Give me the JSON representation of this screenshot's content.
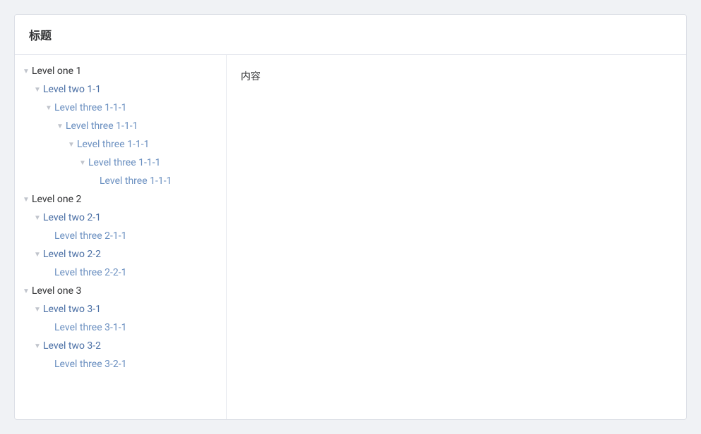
{
  "header": {
    "title": "标题"
  },
  "content": {
    "text": "内容"
  },
  "tree": [
    {
      "id": "one1",
      "label": "Level one 1",
      "level": "level-one",
      "indent": 0,
      "arrow": "expanded",
      "children": [
        {
          "id": "two1-1",
          "label": "Level two 1-1",
          "level": "level-two",
          "indent": 1,
          "arrow": "expanded",
          "children": [
            {
              "id": "three1-1-1a",
              "label": "Level three 1-1-1",
              "level": "level-three",
              "indent": 2,
              "arrow": "expanded",
              "children": [
                {
                  "id": "three1-1-1b",
                  "label": "Level three 1-1-1",
                  "level": "level-three",
                  "indent": 3,
                  "arrow": "expanded",
                  "children": [
                    {
                      "id": "three1-1-1c",
                      "label": "Level three 1-1-1",
                      "level": "level-three",
                      "indent": 4,
                      "arrow": "expanded",
                      "children": [
                        {
                          "id": "three1-1-1d",
                          "label": "Level three 1-1-1",
                          "level": "level-three",
                          "indent": 5,
                          "arrow": "expanded",
                          "children": [
                            {
                              "id": "three1-1-1e",
                              "label": "Level three 1-1-1",
                              "level": "level-three",
                              "indent": 6,
                              "arrow": "leaf",
                              "children": []
                            }
                          ]
                        }
                      ]
                    }
                  ]
                }
              ]
            }
          ]
        }
      ]
    },
    {
      "id": "one2",
      "label": "Level one 2",
      "level": "level-one",
      "indent": 0,
      "arrow": "expanded",
      "children": [
        {
          "id": "two2-1",
          "label": "Level two 2-1",
          "level": "level-two",
          "indent": 1,
          "arrow": "expanded",
          "children": [
            {
              "id": "three2-1-1",
              "label": "Level three 2-1-1",
              "level": "level-three",
              "indent": 2,
              "arrow": "leaf",
              "children": []
            }
          ]
        },
        {
          "id": "two2-2",
          "label": "Level two 2-2",
          "level": "level-two",
          "indent": 1,
          "arrow": "expanded",
          "children": [
            {
              "id": "three2-2-1",
              "label": "Level three 2-2-1",
              "level": "level-three",
              "indent": 2,
              "arrow": "leaf",
              "children": []
            }
          ]
        }
      ]
    },
    {
      "id": "one3",
      "label": "Level one 3",
      "level": "level-one",
      "indent": 0,
      "arrow": "expanded",
      "children": [
        {
          "id": "two3-1",
          "label": "Level two 3-1",
          "level": "level-two",
          "indent": 1,
          "arrow": "expanded",
          "children": [
            {
              "id": "three3-1-1",
              "label": "Level three 3-1-1",
              "level": "level-three",
              "indent": 2,
              "arrow": "leaf",
              "children": []
            }
          ]
        },
        {
          "id": "two3-2",
          "label": "Level two 3-2",
          "level": "level-two",
          "indent": 1,
          "arrow": "expanded",
          "children": [
            {
              "id": "three3-2-1",
              "label": "Level three 3-2-1",
              "level": "level-three",
              "indent": 2,
              "arrow": "leaf",
              "children": []
            }
          ]
        }
      ]
    }
  ]
}
